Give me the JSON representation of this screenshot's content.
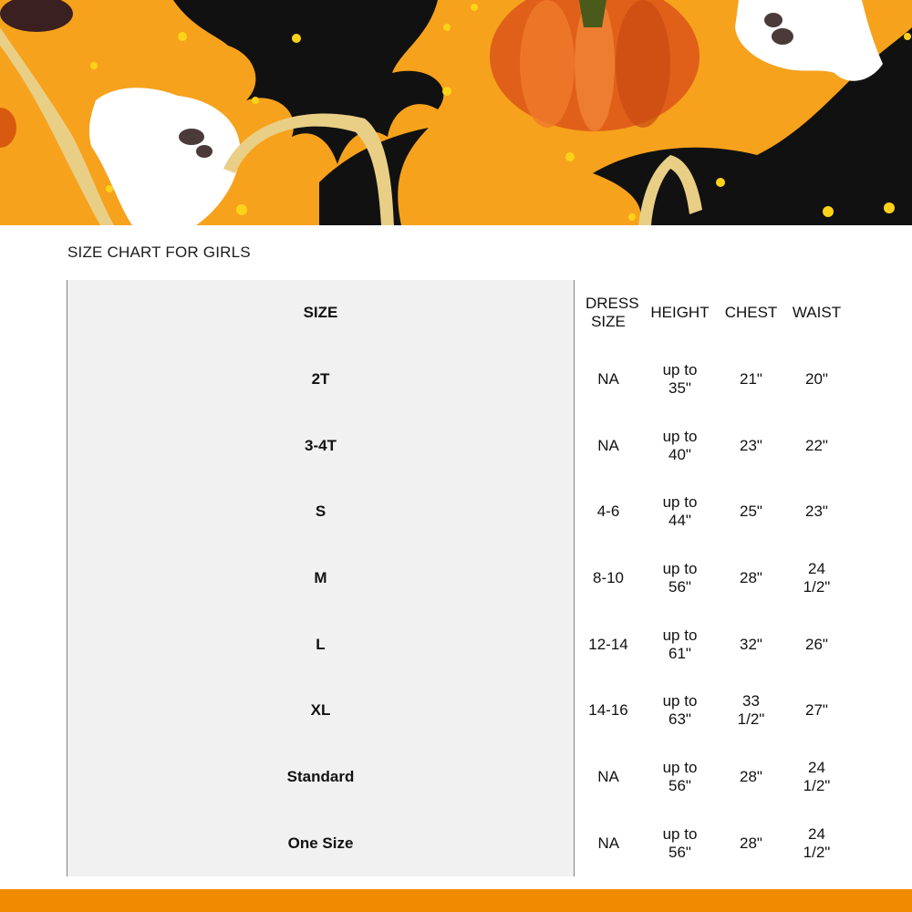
{
  "banner": {
    "colors": {
      "background": "#f6a21c",
      "bat": "#101010",
      "ghost": "#ffffff",
      "pumpkin": "#e0601a",
      "ribbon": "#e9cf86",
      "star": "#ffd21a"
    }
  },
  "title": "SIZE CHART FOR GIRLS",
  "table": {
    "headers": {
      "size": "SIZE",
      "dress_size": "DRESS SIZE",
      "height": "HEIGHT",
      "chest": "CHEST",
      "waist": "WAIST"
    },
    "rows": [
      {
        "size": "2T",
        "dress": "NA",
        "height": "up to 35\"",
        "chest": "21\"",
        "waist": "20\""
      },
      {
        "size": "3-4T",
        "dress": "NA",
        "height": "up to 40\"",
        "chest": "23\"",
        "waist": "22\""
      },
      {
        "size": "S",
        "dress": "4-6",
        "height": "up to 44\"",
        "chest": "25\"",
        "waist": "23\""
      },
      {
        "size": "M",
        "dress": "8-10",
        "height": "up to 56\"",
        "chest": "28\"",
        "waist": "24 1/2\""
      },
      {
        "size": "L",
        "dress": "12-14",
        "height": "up to 61\"",
        "chest": "32\"",
        "waist": "26\""
      },
      {
        "size": "XL",
        "dress": "14-16",
        "height": "up to 63\"",
        "chest": "33 1/2\"",
        "waist": "27\""
      },
      {
        "size": "Standard",
        "dress": "NA",
        "height": "up to 56\"",
        "chest": "28\"",
        "waist": "24 1/2\""
      },
      {
        "size": "One Size",
        "dress": "NA",
        "height": "up to 56\"",
        "chest": "28\"",
        "waist": "24 1/2\""
      }
    ]
  },
  "footer": {
    "color": "#f28a00"
  }
}
